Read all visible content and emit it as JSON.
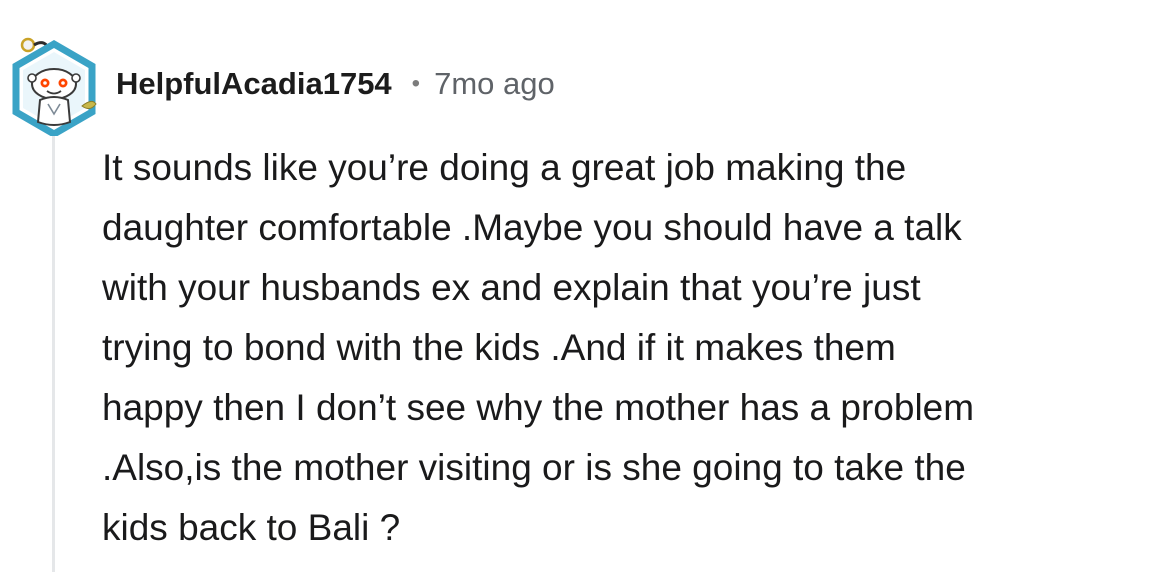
{
  "comment": {
    "author": "HelpfulAcadia1754",
    "separator": "•",
    "timestamp": "7mo ago",
    "body_lines": [
      "It sounds like you’re doing a great job making the",
      "daughter comfortable .Maybe you should have a talk",
      "with your husbands ex and explain that you’re just",
      "trying to bond with the kids .And if it makes them",
      "happy then I don’t see why the mother has a problem",
      ".Also,is the mother visiting or is she going to take the",
      "kids back to Bali ?"
    ]
  },
  "colors": {
    "avatar_border": "#3aa3c6",
    "avatar_bg": "#ffffff",
    "username": "#1c1c1c",
    "meta": "#5f6368",
    "thread_line": "#e5e7e9"
  },
  "icons": {
    "avatar": "snoo-avatar-icon"
  }
}
